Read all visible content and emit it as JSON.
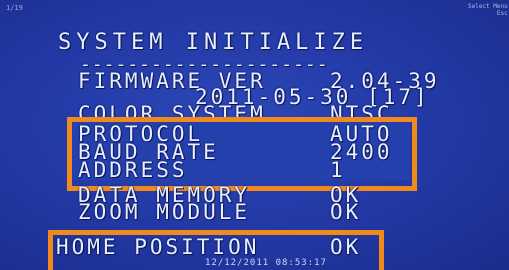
{
  "header": {
    "corner_left": "1/19",
    "corner_right": [
      "Select Menu",
      "Esc"
    ]
  },
  "title": "SYSTEM INITIALIZE",
  "separator": "---------------------",
  "rows": [
    {
      "label": "FIRMWARE VER",
      "value": "2.04-39"
    },
    {
      "label": "",
      "value": "2011-05-30 [17]"
    },
    {
      "label": "COLOR SYSTEM",
      "value": "NTSC"
    },
    {
      "label": "PROTOCOL",
      "value": "AUTO"
    },
    {
      "label": "BAUD RATE",
      "value": "2400"
    },
    {
      "label": "ADDRESS",
      "value": "1"
    },
    {
      "label": "DATA MEMORY",
      "value": "OK"
    },
    {
      "label": "ZOOM MODULE",
      "value": "OK"
    },
    {
      "label": "HOME POSITION",
      "value": "OK"
    }
  ],
  "timestamp": "12/12/2011 08:53:17",
  "highlight_color": "#f08a1c"
}
